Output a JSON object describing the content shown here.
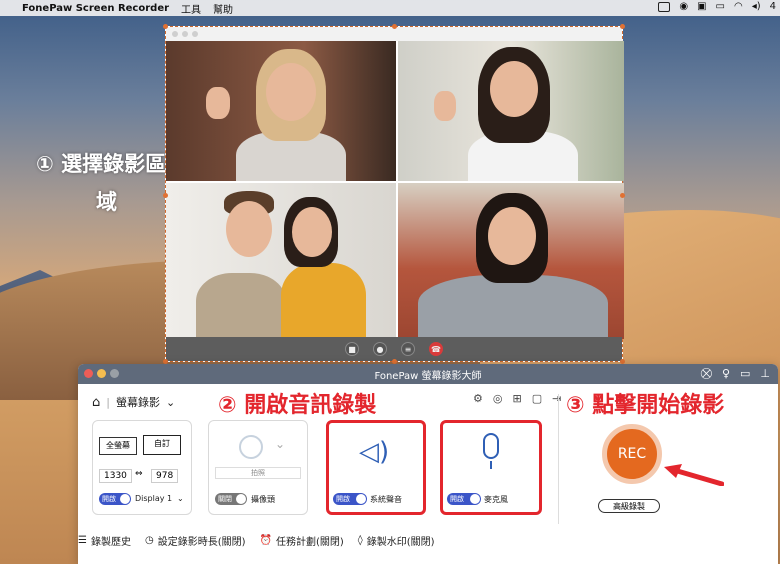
{
  "menubar": {
    "app_name": "FonePaw Screen Recorder",
    "menu_tools": "工具",
    "menu_help": "幫助",
    "clock": "4"
  },
  "annotations": {
    "step1_line1": "① 選擇錄影區",
    "step1_line2": "域",
    "step2": "② 開啟音訊錄製",
    "step3": "③ 點擊開始錄影"
  },
  "recorder": {
    "title": "FonePaw 螢幕錄影大師",
    "mode_label": "螢幕錄影",
    "screen": {
      "fullscreen_label": "全螢幕",
      "custom_label": "自訂",
      "width": "1330",
      "height": "978",
      "toggle_label": "開啟",
      "display_label": "Display 1"
    },
    "webcam": {
      "photo_label": "拍照",
      "toggle_label": "關閉",
      "label": "攝像頭"
    },
    "system_sound": {
      "toggle_label": "開啟",
      "label": "系統聲音"
    },
    "microphone": {
      "toggle_label": "開啟",
      "label": "麥克風"
    },
    "rec_label": "REC",
    "advanced_label": "高級錄製",
    "bottom": {
      "history": "錄製歷史",
      "duration": "設定錄影時長(關閉)",
      "schedule": "任務計劃(關閉)",
      "watermark": "錄製水印(關閉)"
    }
  },
  "colors": {
    "accent_red": "#e3262d",
    "rec_orange": "#e4691f",
    "toggle_on": "#3b55c8"
  }
}
